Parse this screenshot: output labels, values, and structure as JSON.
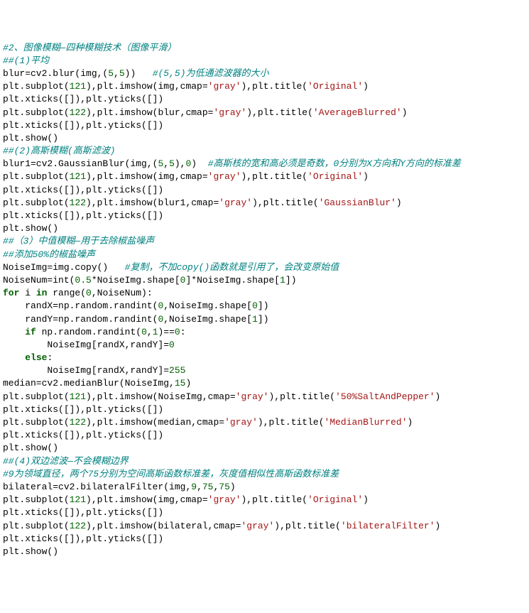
{
  "lines": [
    {
      "seg": [
        {
          "cls": "c-comment",
          "t": "#2、图像模糊—四种模糊技术（图像平滑）"
        }
      ]
    },
    {
      "seg": [
        {
          "cls": "c-comment",
          "t": "##(1)平均"
        }
      ]
    },
    {
      "seg": [
        {
          "cls": "c-plain",
          "t": "blur=cv2.blur(img,("
        },
        {
          "cls": "c-num",
          "t": "5"
        },
        {
          "cls": "c-plain",
          "t": ","
        },
        {
          "cls": "c-num",
          "t": "5"
        },
        {
          "cls": "c-plain",
          "t": "))   "
        },
        {
          "cls": "c-comment",
          "t": "#(5,5)为低通滤波器的大小"
        }
      ]
    },
    {
      "seg": [
        {
          "cls": "c-plain",
          "t": "plt.subplot("
        },
        {
          "cls": "c-num",
          "t": "121"
        },
        {
          "cls": "c-plain",
          "t": "),plt.imshow(img,cmap="
        },
        {
          "cls": "c-str",
          "t": "'gray'"
        },
        {
          "cls": "c-plain",
          "t": "),plt.title("
        },
        {
          "cls": "c-str",
          "t": "'Original'"
        },
        {
          "cls": "c-plain",
          "t": ")"
        }
      ]
    },
    {
      "seg": [
        {
          "cls": "c-plain",
          "t": "plt.xticks([]),plt.yticks([])"
        }
      ]
    },
    {
      "seg": [
        {
          "cls": "c-plain",
          "t": "plt.subplot("
        },
        {
          "cls": "c-num",
          "t": "122"
        },
        {
          "cls": "c-plain",
          "t": "),plt.imshow(blur,cmap="
        },
        {
          "cls": "c-str",
          "t": "'gray'"
        },
        {
          "cls": "c-plain",
          "t": "),plt.title("
        },
        {
          "cls": "c-str",
          "t": "'AverageBlurred'"
        },
        {
          "cls": "c-plain",
          "t": ")"
        }
      ]
    },
    {
      "seg": [
        {
          "cls": "c-plain",
          "t": "plt.xticks([]),plt.yticks([])"
        }
      ]
    },
    {
      "seg": [
        {
          "cls": "c-plain",
          "t": "plt.show()"
        }
      ]
    },
    {
      "seg": [
        {
          "cls": "c-comment",
          "t": "##(2)高斯模糊(高斯滤波)"
        }
      ]
    },
    {
      "seg": [
        {
          "cls": "c-plain",
          "t": "blur1=cv2.GaussianBlur(img,("
        },
        {
          "cls": "c-num",
          "t": "5"
        },
        {
          "cls": "c-plain",
          "t": ","
        },
        {
          "cls": "c-num",
          "t": "5"
        },
        {
          "cls": "c-plain",
          "t": "),"
        },
        {
          "cls": "c-num",
          "t": "0"
        },
        {
          "cls": "c-plain",
          "t": ")  "
        },
        {
          "cls": "c-comment",
          "t": "#高斯核的宽和高必须是奇数，0分别为X方向和Y方向的标准差"
        }
      ]
    },
    {
      "seg": [
        {
          "cls": "c-plain",
          "t": "plt.subplot("
        },
        {
          "cls": "c-num",
          "t": "121"
        },
        {
          "cls": "c-plain",
          "t": "),plt.imshow(img,cmap="
        },
        {
          "cls": "c-str",
          "t": "'gray'"
        },
        {
          "cls": "c-plain",
          "t": "),plt.title("
        },
        {
          "cls": "c-str",
          "t": "'Original'"
        },
        {
          "cls": "c-plain",
          "t": ")"
        }
      ]
    },
    {
      "seg": [
        {
          "cls": "c-plain",
          "t": "plt.xticks([]),plt.yticks([])"
        }
      ]
    },
    {
      "seg": [
        {
          "cls": "c-plain",
          "t": "plt.subplot("
        },
        {
          "cls": "c-num",
          "t": "122"
        },
        {
          "cls": "c-plain",
          "t": "),plt.imshow(blur1,cmap="
        },
        {
          "cls": "c-str",
          "t": "'gray'"
        },
        {
          "cls": "c-plain",
          "t": "),plt.title("
        },
        {
          "cls": "c-str",
          "t": "'GaussianBlur'"
        },
        {
          "cls": "c-plain",
          "t": ")"
        }
      ]
    },
    {
      "seg": [
        {
          "cls": "c-plain",
          "t": "plt.xticks([]),plt.yticks([])"
        }
      ]
    },
    {
      "seg": [
        {
          "cls": "c-plain",
          "t": "plt.show()"
        }
      ]
    },
    {
      "seg": [
        {
          "cls": "c-comment",
          "t": "##（3）中值模糊—用于去除椒盐噪声"
        }
      ]
    },
    {
      "seg": [
        {
          "cls": "c-comment",
          "t": "##添加50%的椒盐噪声"
        }
      ]
    },
    {
      "seg": [
        {
          "cls": "c-plain",
          "t": "NoiseImg=img.copy()   "
        },
        {
          "cls": "c-comment",
          "t": "#复制，不加copy()函数就是引用了，会改变原始值"
        }
      ]
    },
    {
      "seg": [
        {
          "cls": "c-plain",
          "t": "NoiseNum=int("
        },
        {
          "cls": "c-num",
          "t": "0.5"
        },
        {
          "cls": "c-plain",
          "t": "*NoiseImg.shape["
        },
        {
          "cls": "c-num",
          "t": "0"
        },
        {
          "cls": "c-plain",
          "t": "]*NoiseImg.shape["
        },
        {
          "cls": "c-num",
          "t": "1"
        },
        {
          "cls": "c-plain",
          "t": "])"
        }
      ]
    },
    {
      "seg": [
        {
          "cls": "c-kw",
          "t": "for"
        },
        {
          "cls": "c-plain",
          "t": " i "
        },
        {
          "cls": "c-kw",
          "t": "in"
        },
        {
          "cls": "c-plain",
          "t": " range("
        },
        {
          "cls": "c-num",
          "t": "0"
        },
        {
          "cls": "c-plain",
          "t": ",NoiseNum):"
        }
      ]
    },
    {
      "seg": [
        {
          "cls": "c-plain",
          "t": "    randX=np.random.randint("
        },
        {
          "cls": "c-num",
          "t": "0"
        },
        {
          "cls": "c-plain",
          "t": ",NoiseImg.shape["
        },
        {
          "cls": "c-num",
          "t": "0"
        },
        {
          "cls": "c-plain",
          "t": "])"
        }
      ]
    },
    {
      "seg": [
        {
          "cls": "c-plain",
          "t": "    randY=np.random.randint("
        },
        {
          "cls": "c-num",
          "t": "0"
        },
        {
          "cls": "c-plain",
          "t": ",NoiseImg.shape["
        },
        {
          "cls": "c-num",
          "t": "1"
        },
        {
          "cls": "c-plain",
          "t": "])"
        }
      ]
    },
    {
      "seg": [
        {
          "cls": "c-plain",
          "t": "    "
        },
        {
          "cls": "c-kw",
          "t": "if"
        },
        {
          "cls": "c-plain",
          "t": " np.random.randint("
        },
        {
          "cls": "c-num",
          "t": "0"
        },
        {
          "cls": "c-plain",
          "t": ","
        },
        {
          "cls": "c-num",
          "t": "1"
        },
        {
          "cls": "c-plain",
          "t": ")=="
        },
        {
          "cls": "c-num",
          "t": "0"
        },
        {
          "cls": "c-plain",
          "t": ":"
        }
      ]
    },
    {
      "seg": [
        {
          "cls": "c-plain",
          "t": "        NoiseImg[randX,randY]="
        },
        {
          "cls": "c-num",
          "t": "0"
        }
      ]
    },
    {
      "seg": [
        {
          "cls": "c-plain",
          "t": "    "
        },
        {
          "cls": "c-kw",
          "t": "else"
        },
        {
          "cls": "c-plain",
          "t": ":"
        }
      ]
    },
    {
      "seg": [
        {
          "cls": "c-plain",
          "t": "        NoiseImg[randX,randY]="
        },
        {
          "cls": "c-num",
          "t": "255"
        }
      ]
    },
    {
      "seg": [
        {
          "cls": "c-plain",
          "t": ""
        }
      ]
    },
    {
      "seg": [
        {
          "cls": "c-plain",
          "t": "median=cv2.medianBlur(NoiseImg,"
        },
        {
          "cls": "c-num",
          "t": "15"
        },
        {
          "cls": "c-plain",
          "t": ")"
        }
      ]
    },
    {
      "seg": [
        {
          "cls": "c-plain",
          "t": "plt.subplot("
        },
        {
          "cls": "c-num",
          "t": "121"
        },
        {
          "cls": "c-plain",
          "t": "),plt.imshow(NoiseImg,cmap="
        },
        {
          "cls": "c-str",
          "t": "'gray'"
        },
        {
          "cls": "c-plain",
          "t": "),plt.title("
        },
        {
          "cls": "c-str",
          "t": "'50%SaltAndPepper'"
        },
        {
          "cls": "c-plain",
          "t": ")"
        }
      ]
    },
    {
      "seg": [
        {
          "cls": "c-plain",
          "t": "plt.xticks([]),plt.yticks([])"
        }
      ]
    },
    {
      "seg": [
        {
          "cls": "c-plain",
          "t": "plt.subplot("
        },
        {
          "cls": "c-num",
          "t": "122"
        },
        {
          "cls": "c-plain",
          "t": "),plt.imshow(median,cmap="
        },
        {
          "cls": "c-str",
          "t": "'gray'"
        },
        {
          "cls": "c-plain",
          "t": "),plt.title("
        },
        {
          "cls": "c-str",
          "t": "'MedianBlurred'"
        },
        {
          "cls": "c-plain",
          "t": ")"
        }
      ]
    },
    {
      "seg": [
        {
          "cls": "c-plain",
          "t": "plt.xticks([]),plt.yticks([])"
        }
      ]
    },
    {
      "seg": [
        {
          "cls": "c-plain",
          "t": "plt.show()"
        }
      ]
    },
    {
      "seg": [
        {
          "cls": "c-comment",
          "t": "##(4)双边滤波—不会模糊边界"
        }
      ]
    },
    {
      "seg": [
        {
          "cls": "c-comment",
          "t": "#9为领域直径，两个75分别为空间高斯函数标准差，灰度值相似性高斯函数标准差"
        }
      ]
    },
    {
      "seg": [
        {
          "cls": "c-plain",
          "t": "bilateral=cv2.bilateralFilter(img,"
        },
        {
          "cls": "c-num",
          "t": "9"
        },
        {
          "cls": "c-plain",
          "t": ","
        },
        {
          "cls": "c-num",
          "t": "75"
        },
        {
          "cls": "c-plain",
          "t": ","
        },
        {
          "cls": "c-num",
          "t": "75"
        },
        {
          "cls": "c-plain",
          "t": ")"
        }
      ]
    },
    {
      "seg": [
        {
          "cls": "c-plain",
          "t": "plt.subplot("
        },
        {
          "cls": "c-num",
          "t": "121"
        },
        {
          "cls": "c-plain",
          "t": "),plt.imshow(img,cmap="
        },
        {
          "cls": "c-str",
          "t": "'gray'"
        },
        {
          "cls": "c-plain",
          "t": "),plt.title("
        },
        {
          "cls": "c-str",
          "t": "'Original'"
        },
        {
          "cls": "c-plain",
          "t": ")"
        }
      ]
    },
    {
      "seg": [
        {
          "cls": "c-plain",
          "t": "plt.xticks([]),plt.yticks([])"
        }
      ]
    },
    {
      "seg": [
        {
          "cls": "c-plain",
          "t": "plt.subplot("
        },
        {
          "cls": "c-num",
          "t": "122"
        },
        {
          "cls": "c-plain",
          "t": "),plt.imshow(bilateral,cmap="
        },
        {
          "cls": "c-str",
          "t": "'gray'"
        },
        {
          "cls": "c-plain",
          "t": "),plt.title("
        },
        {
          "cls": "c-str",
          "t": "'bilateralFilter'"
        },
        {
          "cls": "c-plain",
          "t": ")"
        }
      ]
    },
    {
      "seg": [
        {
          "cls": "c-plain",
          "t": "plt.xticks([]),plt.yticks([])"
        }
      ]
    },
    {
      "seg": [
        {
          "cls": "c-plain",
          "t": "plt.show()"
        }
      ]
    }
  ]
}
